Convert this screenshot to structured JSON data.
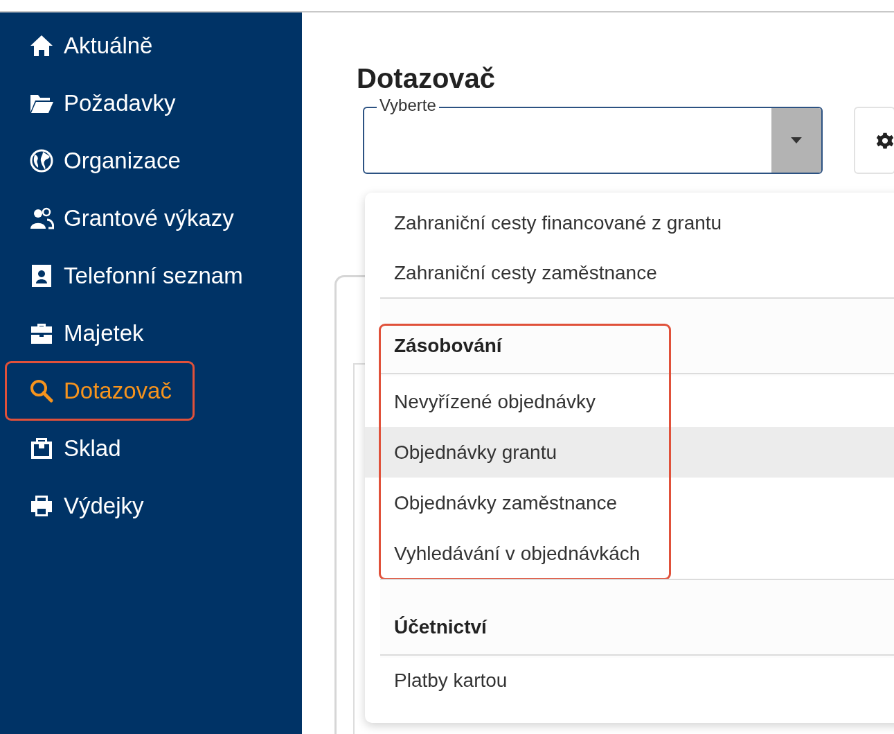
{
  "sidebar": {
    "items": [
      {
        "label": "Aktuálně",
        "selected": false,
        "highlighted": false
      },
      {
        "label": "Požadavky",
        "selected": false,
        "highlighted": false
      },
      {
        "label": "Organizace",
        "selected": false,
        "highlighted": false
      },
      {
        "label": "Grantové výkazy",
        "selected": false,
        "highlighted": false
      },
      {
        "label": "Telefonní seznam",
        "selected": false,
        "highlighted": false
      },
      {
        "label": "Majetek",
        "selected": false,
        "highlighted": false
      },
      {
        "label": "Dotazovač",
        "selected": true,
        "highlighted": true
      },
      {
        "label": "Sklad",
        "selected": false,
        "highlighted": false
      },
      {
        "label": "Výdejky",
        "selected": false,
        "highlighted": false
      }
    ]
  },
  "page": {
    "title": "Dotazovač"
  },
  "select": {
    "label": "Vyberte"
  },
  "dropdown": {
    "groups": [
      {
        "highlighted": false,
        "items": [
          {
            "label": "Zahraniční cesty financované z grantu",
            "hovered": false
          },
          {
            "label": "Zahraniční cesty zaměstnance",
            "hovered": false
          }
        ]
      },
      {
        "header": "Zásobování",
        "highlighted": true,
        "items": [
          {
            "label": "Nevyřízené objednávky",
            "hovered": false
          },
          {
            "label": "Objednávky grantu",
            "hovered": true
          },
          {
            "label": "Objednávky zaměstnance",
            "hovered": false
          },
          {
            "label": "Vyhledávání v objednávkách",
            "hovered": false
          }
        ]
      },
      {
        "header": "Účetnictví",
        "highlighted": false,
        "items": [
          {
            "label": "Platby kartou",
            "hovered": false
          }
        ]
      }
    ]
  }
}
